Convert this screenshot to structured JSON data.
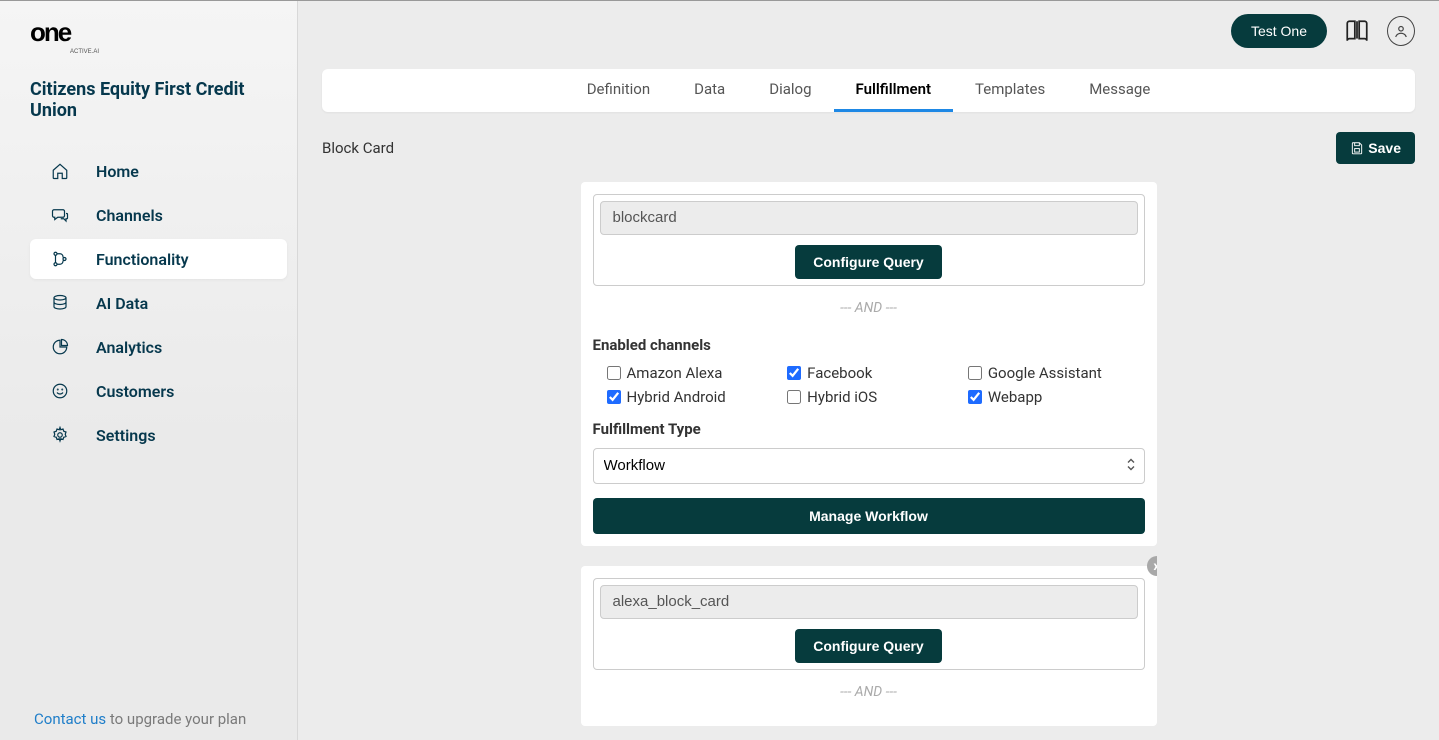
{
  "brand": {
    "tagline": "ACTIVE.AI"
  },
  "org": "Citizens Equity First Credit Union",
  "sidebar": {
    "items": [
      {
        "label": "Home"
      },
      {
        "label": "Channels"
      },
      {
        "label": "Functionality"
      },
      {
        "label": "AI Data"
      },
      {
        "label": "Analytics"
      },
      {
        "label": "Customers"
      },
      {
        "label": "Settings"
      }
    ],
    "contact_link": "Contact us",
    "contact_rest": " to upgrade your plan"
  },
  "topbar": {
    "test_button": "Test One"
  },
  "tabs": [
    {
      "label": "Definition"
    },
    {
      "label": "Data"
    },
    {
      "label": "Dialog"
    },
    {
      "label": "Fullfillment"
    },
    {
      "label": "Templates"
    },
    {
      "label": "Message"
    }
  ],
  "page": {
    "title": "Block Card",
    "save_label": "Save"
  },
  "cards": [
    {
      "query_value": "blockcard",
      "configure_label": "Configure Query",
      "and_sep": "--- AND ---",
      "enabled_label": "Enabled channels",
      "channels": [
        {
          "name": "Amazon Alexa",
          "checked": false
        },
        {
          "name": "Facebook",
          "checked": true
        },
        {
          "name": "Google Assistant",
          "checked": false
        },
        {
          "name": "Hybrid Android",
          "checked": true
        },
        {
          "name": "Hybrid iOS",
          "checked": false
        },
        {
          "name": "Webapp",
          "checked": true
        }
      ],
      "ftype_label": "Fulfillment Type",
      "ftype_value": "Workflow",
      "workflow_btn": "Manage Workflow"
    },
    {
      "query_value": "alexa_block_card",
      "configure_label": "Configure Query",
      "and_sep": "--- AND ---",
      "close": "x"
    }
  ]
}
